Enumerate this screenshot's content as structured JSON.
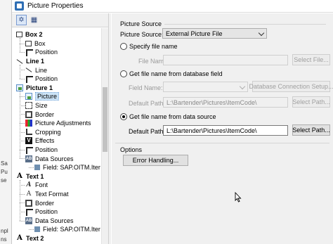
{
  "window": {
    "title": "Picture Properties"
  },
  "left_strip": {
    "fragments": [
      "Sa",
      "Pu",
      "se",
      "npl",
      "ns"
    ]
  },
  "tree": {
    "items": [
      {
        "label": "Box 2",
        "icon": "box-icon",
        "level": 0
      },
      {
        "label": "Box",
        "icon": "box-icon",
        "level": 1
      },
      {
        "label": "Position",
        "icon": "position-icon",
        "level": 1
      },
      {
        "label": "Line 1",
        "icon": "line-icon",
        "level": 0
      },
      {
        "label": "Line",
        "icon": "line-icon",
        "level": 1
      },
      {
        "label": "Position",
        "icon": "position-icon",
        "level": 1
      },
      {
        "label": "Picture 1",
        "icon": "picture-icon",
        "level": 0
      },
      {
        "label": "Picture",
        "icon": "picture-icon",
        "level": 1,
        "selected": true
      },
      {
        "label": "Size",
        "icon": "size-icon",
        "level": 1
      },
      {
        "label": "Border",
        "icon": "border-icon",
        "level": 1
      },
      {
        "label": "Picture Adjustments",
        "icon": "picture-adjustments-icon",
        "level": 1
      },
      {
        "label": "Cropping",
        "icon": "cropping-icon",
        "level": 1
      },
      {
        "label": "Effects",
        "icon": "effects-icon",
        "level": 1
      },
      {
        "label": "Position",
        "icon": "position-icon",
        "level": 1
      },
      {
        "label": "Data Sources",
        "icon": "data-sources-icon",
        "level": 1
      },
      {
        "label": "Field: SAP.OITM.Iter",
        "icon": "field-icon",
        "level": 2
      },
      {
        "label": "Text 1",
        "icon": "text-icon",
        "level": 0
      },
      {
        "label": "Font",
        "icon": "font-icon",
        "level": 1
      },
      {
        "label": "Text Format",
        "icon": "text-format-icon",
        "level": 1
      },
      {
        "label": "Border",
        "icon": "border-icon",
        "level": 1
      },
      {
        "label": "Position",
        "icon": "position-icon",
        "level": 1
      },
      {
        "label": "Data Sources",
        "icon": "data-sources-icon",
        "level": 1
      },
      {
        "label": "Field: SAP.OITM.Iter",
        "icon": "field-icon",
        "level": 2
      },
      {
        "label": "Text 2",
        "icon": "text-icon",
        "level": 0
      }
    ]
  },
  "picture_source": {
    "group_title": "Picture Source",
    "source_label": "Picture Source:",
    "source_value": "External Picture File",
    "opt_specify": "Specify file name",
    "file_name_label": "File Name:",
    "file_name_value": "",
    "select_file_btn": "Select File...",
    "opt_database": "Get file name from database field",
    "field_name_label": "Field Name:",
    "field_name_value": "",
    "db_conn_btn": "Database Connection Setup...",
    "db_default_path_label": "Default Path:",
    "db_default_path_value": "L:\\Bartender\\Pictures\\ItemCode\\",
    "db_select_path_btn": "Select Path...",
    "opt_data_source": "Get file name from data source",
    "ds_default_path_label": "Default Path:",
    "ds_default_path_value": "L:\\Bartender\\Pictures\\ItemCode\\",
    "ds_select_path_btn": "Select Path..."
  },
  "options": {
    "group_title": "Options",
    "error_handling_btn": "Error Handling..."
  }
}
